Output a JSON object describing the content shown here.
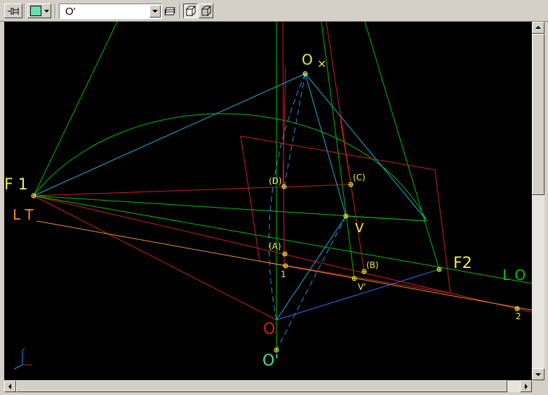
{
  "toolbar": {
    "view_combo": {
      "value": "O'"
    },
    "icons": {
      "pin": "pin-icon",
      "color": "color-swatch-icon",
      "layers": "layers-icon",
      "view3d": "cube-view-icon",
      "viewwire": "wireframe-cube-icon"
    },
    "swatch_color": "#66e0b0"
  },
  "drawing": {
    "labels": {
      "ox": "O",
      "ox_mark": "×",
      "f1": "F 1",
      "lt": "L T",
      "d": "(D)",
      "c": "(C)",
      "v": "V",
      "a": "(A)",
      "one": "1",
      "b": "(B)",
      "f2": "F2",
      "lo": "L O",
      "vprime": "V'",
      "o": "O",
      "two": "2",
      "oprime": "O'"
    },
    "colors": {
      "background": "#000000",
      "green": "#00c000",
      "red": "#d02020",
      "cyan": "#20b0e0",
      "blue": "#3070f0",
      "orange": "#f09020",
      "yellow": "#f0f040",
      "dashed": "#3090e0"
    }
  }
}
